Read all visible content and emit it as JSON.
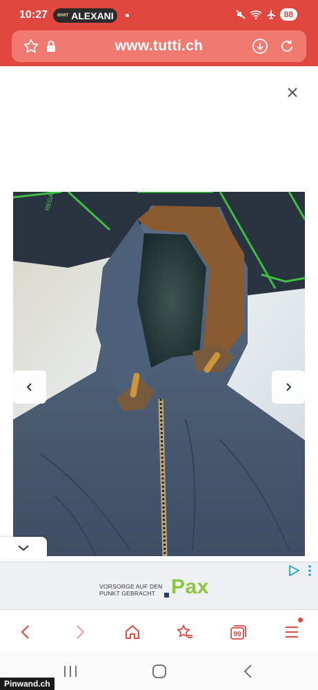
{
  "status_bar": {
    "time": "10:27",
    "live_label": "RPRT",
    "live_text": "ALEXANI",
    "battery": "88"
  },
  "address_bar": {
    "url": "www.tutti.ch"
  },
  "ad": {
    "slogan_line1": "VORSORGE AUF DEN",
    "slogan_line2": "PUNKT GEBRACHT",
    "brand": "Pax"
  },
  "watermark": "Pinwand.ch",
  "colors": {
    "brand_red": "#e0473e",
    "pax_green": "#8cc63f",
    "icon_grey": "#555555"
  },
  "icons": [
    "star-icon",
    "lock-icon",
    "download-icon",
    "reload-icon",
    "close-icon",
    "chevron-left-icon",
    "chevron-right-icon",
    "chevron-down-icon",
    "home-icon",
    "bookmarks-icon",
    "tabs-icon",
    "menu-icon",
    "ad-choices-icon"
  ],
  "toolbar": {
    "tabs_count": "99"
  }
}
